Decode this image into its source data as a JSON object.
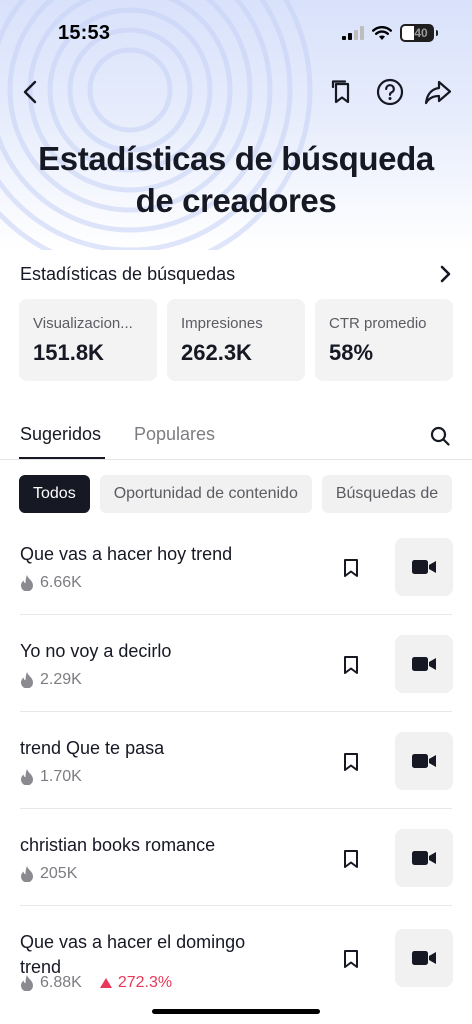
{
  "status_bar": {
    "time": "15:53",
    "battery": "40"
  },
  "nav": {
    "back_icon": "chevron-left-icon",
    "actions": [
      "bookmark-icon",
      "help-icon",
      "share-icon"
    ]
  },
  "page_title": "Estadísticas de búsqueda de creadores",
  "stats_section": {
    "title": "Estadísticas de búsquedas",
    "cards": [
      {
        "label": "Visualizacion...",
        "value": "151.8K"
      },
      {
        "label": "Impresiones",
        "value": "262.3K"
      },
      {
        "label": "CTR promedio",
        "value": "58%"
      }
    ]
  },
  "tabs": {
    "active": "Sugeridos",
    "inactive": "Populares"
  },
  "chips": [
    "Todos",
    "Oportunidad de contenido",
    "Búsquedas de"
  ],
  "items": [
    {
      "title": "Que vas a hacer hoy trend",
      "views": "6.66K"
    },
    {
      "title": "Yo no voy a decirlo",
      "views": "2.29K"
    },
    {
      "title": "trend Que te pasa",
      "views": "1.70K"
    },
    {
      "title": "christian books romance",
      "views": "205K"
    },
    {
      "title": "Que vas a hacer el domingo trend",
      "views": "6.88K",
      "trend": "272.3%"
    }
  ],
  "colors": {
    "accent_trend": "#e8375a",
    "text_primary": "#161823",
    "text_secondary": "#7c7c82"
  }
}
